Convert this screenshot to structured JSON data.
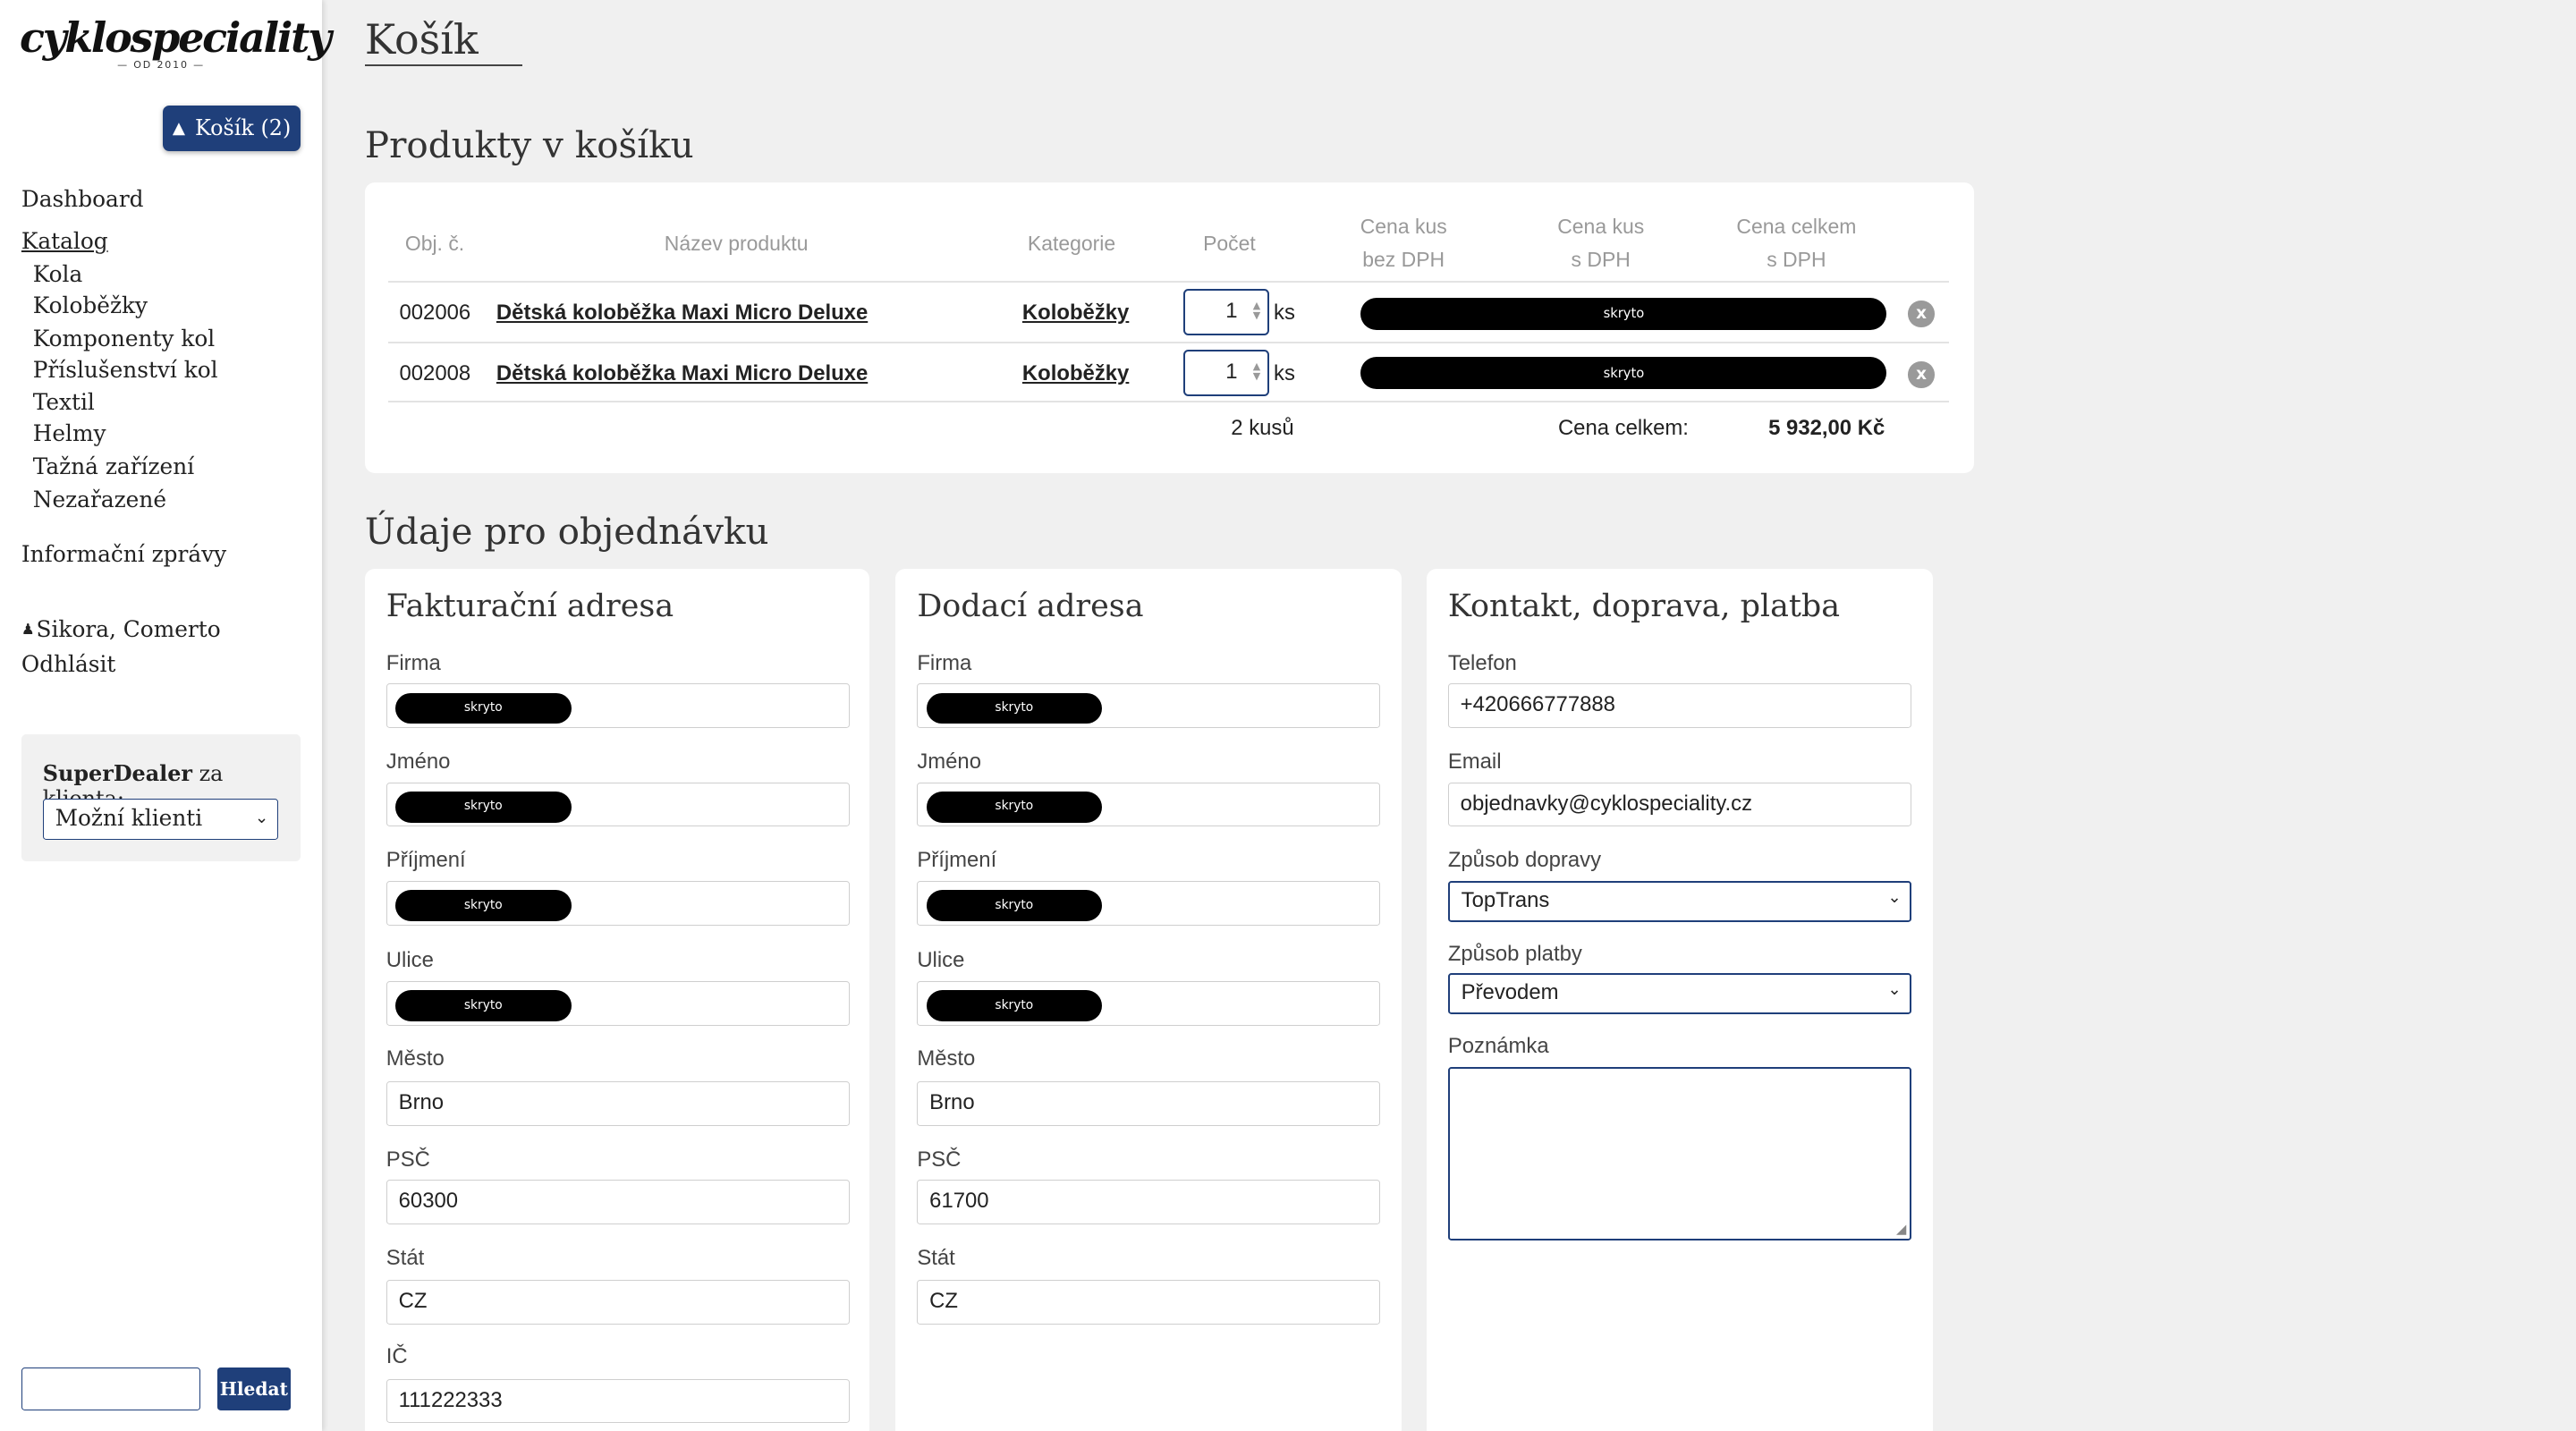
{
  "sidebar": {
    "logo_text": "cyklospeciality",
    "logo_sub": "— OD 2010 —",
    "cart_label": "Košík (2)",
    "nav": {
      "dashboard": "Dashboard",
      "catalog": "Katalog",
      "catalog_items": [
        "Kola",
        "Koloběžky",
        "Komponenty kol",
        "Příslušenství kol",
        "Textil",
        "Helmy",
        "Tažná zařízení",
        "Nezařazené"
      ],
      "info": "Informační zprávy",
      "user": "Sikora, Comerto",
      "logout": "Odhlásit"
    },
    "superdealer": {
      "label_bold": "SuperDealer",
      "label_rest": " za klienta:",
      "select_value": "Možní klienti"
    },
    "search": {
      "value": "",
      "button": "Hledat"
    }
  },
  "page_title": "Košík",
  "cart": {
    "section_title": "Produkty v košíku",
    "headers": {
      "order_no": "Obj. č.",
      "name": "Název produktu",
      "category": "Kategorie",
      "count": "Počet",
      "price_ex_1": "Cena kus",
      "price_ex_2": "bez DPH",
      "price_inc_1": "Cena kus",
      "price_inc_2": "s DPH",
      "total_1": "Cena celkem",
      "total_2": "s DPH"
    },
    "rows": [
      {
        "order_no": "002006",
        "name": "Dětská koloběžka Maxi Micro Deluxe",
        "category": "Koloběžky",
        "qty": "1",
        "unit": "ks",
        "hidden": "skryto"
      },
      {
        "order_no": "002008",
        "name": "Dětská koloběžka Maxi Micro Deluxe",
        "category": "Koloběžky",
        "qty": "1",
        "unit": "ks",
        "hidden": "skryto"
      }
    ],
    "footer": {
      "count_total": "2 kusů",
      "total_label": "Cena celkem:",
      "total_value": "5 932,00 Kč"
    }
  },
  "order": {
    "section_title": "Údaje pro objednávku",
    "billing": {
      "title": "Fakturační adresa",
      "company_label": "Firma",
      "first_label": "Jméno",
      "last_label": "Příjmení",
      "street_label": "Ulice",
      "city_label": "Město",
      "city": "Brno",
      "zip_label": "PSČ",
      "zip": "60300",
      "country_label": "Stát",
      "country": "CZ",
      "ic_label": "IČ",
      "ic": "111222333",
      "hidden": "skryto"
    },
    "delivery": {
      "title": "Dodací adresa",
      "company_label": "Firma",
      "first_label": "Jméno",
      "last_label": "Příjmení",
      "street_label": "Ulice",
      "city_label": "Město",
      "city": "Brno",
      "zip_label": "PSČ",
      "zip": "61700",
      "country_label": "Stát",
      "country": "CZ",
      "hidden": "skryto"
    },
    "contact": {
      "title": "Kontakt, doprava, platba",
      "phone_label": "Telefon",
      "phone": "+420666777888",
      "email_label": "Email",
      "email": "objednavky@cyklospeciality.cz",
      "shipping_label": "Způsob dopravy",
      "shipping": "TopTrans",
      "payment_label": "Způsob platby",
      "payment": "Převodem",
      "note_label": "Poznámka",
      "note": ""
    }
  },
  "colors": {
    "brand": "#1f3f7a",
    "background": "#f0f0f0"
  }
}
